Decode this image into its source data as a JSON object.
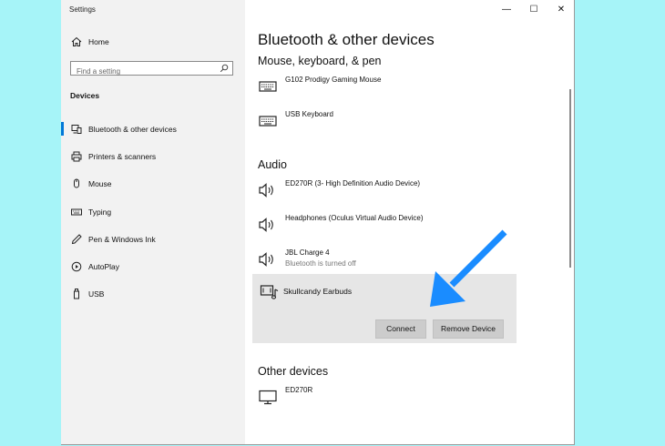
{
  "window": {
    "title": "Settings",
    "controls": {
      "minimize": "—",
      "maximize": "☐",
      "close": "✕"
    }
  },
  "sidebar": {
    "home_label": "Home",
    "search_placeholder": "Find a setting",
    "section_title": "Devices",
    "items": [
      {
        "label": "Bluetooth & other devices",
        "icon": "bluetooth-devices-icon",
        "active": true
      },
      {
        "label": "Printers & scanners",
        "icon": "printer-icon"
      },
      {
        "label": "Mouse",
        "icon": "mouse-icon"
      },
      {
        "label": "Typing",
        "icon": "keyboard-icon"
      },
      {
        "label": "Pen & Windows Ink",
        "icon": "pen-icon"
      },
      {
        "label": "AutoPlay",
        "icon": "autoplay-icon"
      },
      {
        "label": "USB",
        "icon": "usb-icon"
      }
    ]
  },
  "main": {
    "title": "Bluetooth & other devices",
    "categories": {
      "input": "Mouse, keyboard, & pen",
      "audio": "Audio",
      "other": "Other devices"
    },
    "input_devices": [
      {
        "name": "G102 Prodigy Gaming Mouse"
      },
      {
        "name": "USB Keyboard"
      }
    ],
    "audio_devices": [
      {
        "name": "ED270R (3- High Definition Audio Device)"
      },
      {
        "name": "Headphones (Oculus Virtual Audio Device)"
      },
      {
        "name": "JBL Charge 4",
        "status": "Bluetooth is turned off"
      }
    ],
    "selected_device": {
      "name": "Skullcandy Earbuds",
      "connect_label": "Connect",
      "remove_label": "Remove Device"
    },
    "other_devices": [
      {
        "name": "ED270R"
      }
    ]
  },
  "colors": {
    "accent": "#0078d7",
    "annotation_arrow": "#1a8cff",
    "background": "#a6f4f8"
  }
}
